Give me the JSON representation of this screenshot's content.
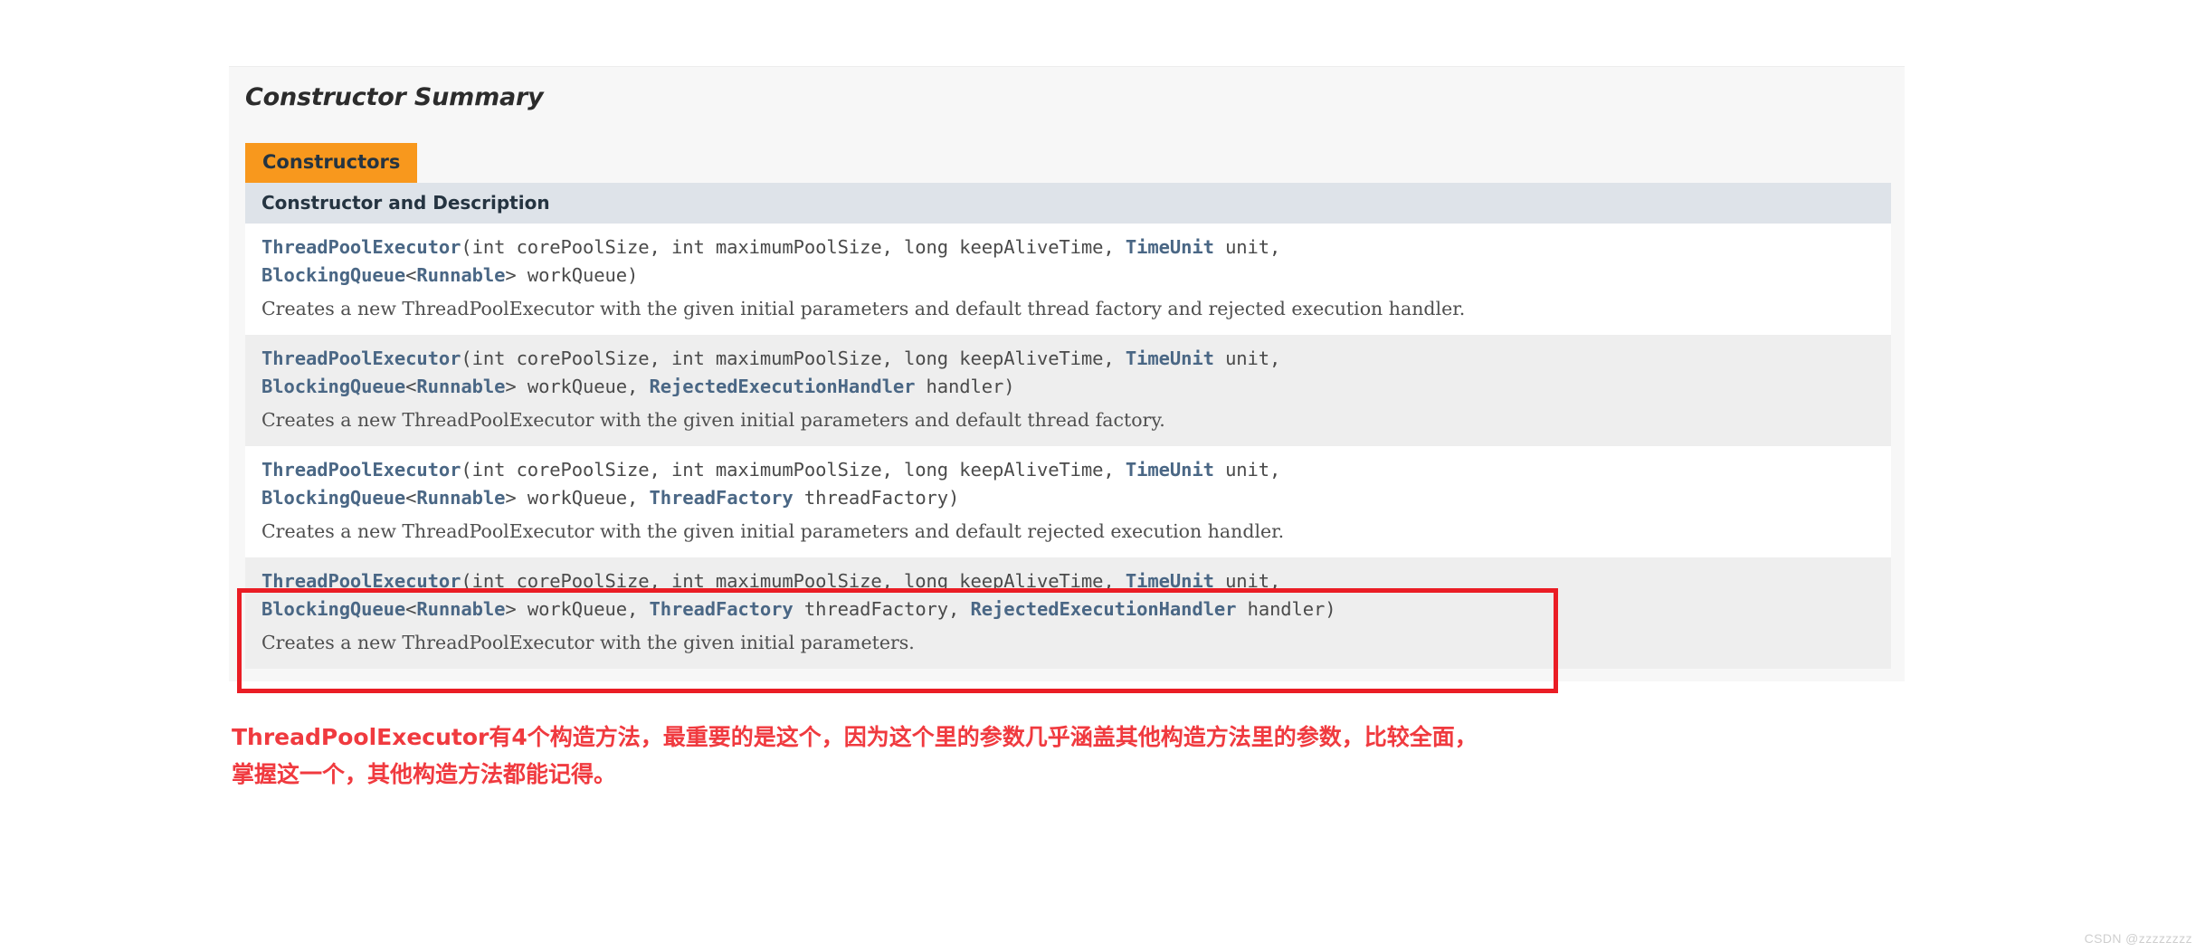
{
  "section": {
    "heading": "Constructor Summary",
    "tab_label": "Constructors",
    "column_header": "Constructor and Description"
  },
  "colors": {
    "tab_background": "#f8981d",
    "table_header_background": "#dee3e9",
    "link_text": "#4a6785",
    "highlight_border": "#ea1d25",
    "annotation_text": "#f03a3f",
    "panel_background": "#f7f7f7",
    "row_alt_background": "#eeeeee"
  },
  "constructors": [
    {
      "sig_line1_pre": "",
      "type_name": "ThreadPoolExecutor",
      "sig_line1_mid": "(int corePoolSize, int maximumPoolSize, long keepAliveTime, ",
      "sig_line1_link2": "TimeUnit",
      "sig_line1_post": " unit,",
      "sig_line2_link1": "BlockingQueue",
      "sig_line2_mid1": "<",
      "sig_line2_link2": "Runnable",
      "sig_line2_mid2": "> workQueue)",
      "sig_line2_link3": "",
      "sig_line2_post": "",
      "description": "Creates a new ThreadPoolExecutor with the given initial parameters and default thread factory and rejected execution handler.",
      "highlighted": false
    },
    {
      "type_name": "ThreadPoolExecutor",
      "sig_line1_mid": "(int corePoolSize, int maximumPoolSize, long keepAliveTime, ",
      "sig_line1_link2": "TimeUnit",
      "sig_line1_post": " unit,",
      "sig_line2_link1": "BlockingQueue",
      "sig_line2_mid1": "<",
      "sig_line2_link2": "Runnable",
      "sig_line2_mid2": "> workQueue, ",
      "sig_line2_link3": "RejectedExecutionHandler",
      "sig_line2_post": " handler)",
      "description": "Creates a new ThreadPoolExecutor with the given initial parameters and default thread factory.",
      "highlighted": false
    },
    {
      "type_name": "ThreadPoolExecutor",
      "sig_line1_mid": "(int corePoolSize, int maximumPoolSize, long keepAliveTime, ",
      "sig_line1_link2": "TimeUnit",
      "sig_line1_post": " unit,",
      "sig_line2_link1": "BlockingQueue",
      "sig_line2_mid1": "<",
      "sig_line2_link2": "Runnable",
      "sig_line2_mid2": "> workQueue, ",
      "sig_line2_link3": "ThreadFactory",
      "sig_line2_post": " threadFactory)",
      "description": "Creates a new ThreadPoolExecutor with the given initial parameters and default rejected execution handler.",
      "highlighted": false
    },
    {
      "type_name": "ThreadPoolExecutor",
      "sig_line1_mid": "(int corePoolSize, int maximumPoolSize, long keepAliveTime, ",
      "sig_line1_link2": "TimeUnit",
      "sig_line1_post": " unit,",
      "sig_line2_link1": "BlockingQueue",
      "sig_line2_mid1": "<",
      "sig_line2_link2": "Runnable",
      "sig_line2_mid2": "> workQueue, ",
      "sig_line2_link3": "ThreadFactory",
      "sig_line2_mid3": " threadFactory, ",
      "sig_line2_link4": "RejectedExecutionHandler",
      "sig_line2_post": " handler)",
      "description": "Creates a new ThreadPoolExecutor with the given initial parameters.",
      "highlighted": true
    }
  ],
  "annotation": {
    "line1": "ThreadPoolExecutor有4个构造方法，最重要的是这个，因为这个里的参数几乎涵盖其他构造方法里的参数，比较全面，",
    "line2": "掌握这一个，其他构造方法都能记得。"
  },
  "watermark": {
    "text": "CSDN @zzzzzzzz"
  }
}
